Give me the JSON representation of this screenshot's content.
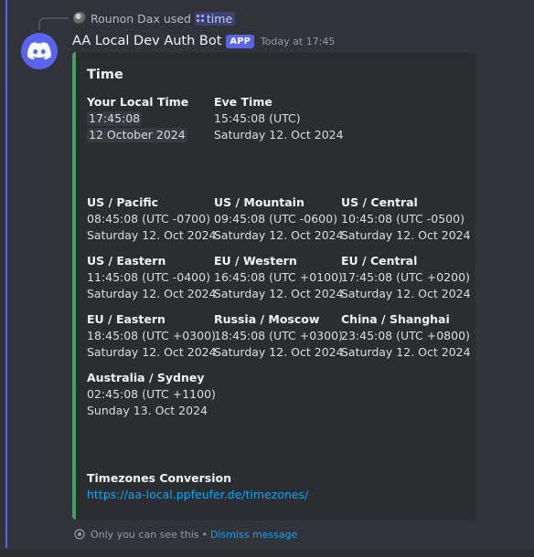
{
  "interaction": {
    "user": "Rounon Dax",
    "used_text": "used",
    "command": "time"
  },
  "message": {
    "author": "AA Local Dev Auth Bot",
    "badge": "APP",
    "timestamp": "Today at 17:45"
  },
  "embed": {
    "accent_color": "#3ba55d",
    "title": "Time",
    "local_time": {
      "name": "Your Local Time",
      "time": "17:45:08",
      "date": "12 October 2024"
    },
    "eve_time": {
      "name": "Eve Time",
      "time": "15:45:08 (UTC)",
      "date": "Saturday 12. Oct 2024"
    },
    "zones": [
      {
        "name": "US / Pacific",
        "time": "08:45:08 (UTC -0700)",
        "date": "Saturday 12. Oct 2024"
      },
      {
        "name": "US / Mountain",
        "time": "09:45:08 (UTC -0600)",
        "date": "Saturday 12. Oct 2024"
      },
      {
        "name": "US / Central",
        "time": "10:45:08 (UTC -0500)",
        "date": "Saturday 12. Oct 2024"
      },
      {
        "name": "US / Eastern",
        "time": "11:45:08 (UTC -0400)",
        "date": "Saturday 12. Oct 2024"
      },
      {
        "name": "EU / Western",
        "time": "16:45:08 (UTC +0100)",
        "date": "Saturday 12. Oct 2024"
      },
      {
        "name": "EU / Central",
        "time": "17:45:08 (UTC +0200)",
        "date": "Saturday 12. Oct 2024"
      },
      {
        "name": "EU / Eastern",
        "time": "18:45:08 (UTC +0300)",
        "date": "Saturday 12. Oct 2024"
      },
      {
        "name": "Russia / Moscow",
        "time": "18:45:08 (UTC +0300)",
        "date": "Saturday 12. Oct 2024"
      },
      {
        "name": "China / Shanghai",
        "time": "23:45:08 (UTC +0800)",
        "date": "Saturday 12. Oct 2024"
      },
      {
        "name": "Australia / Sydney",
        "time": "02:45:08 (UTC +1100)",
        "date": "Sunday 13. Oct 2024"
      }
    ],
    "conversion": {
      "name": "Timezones Conversion",
      "link": "https://aa-local.ppfeufer.de/timezones/"
    }
  },
  "footer": {
    "text": "Only you can see this",
    "separator": "•",
    "dismiss": "Dismiss message"
  }
}
